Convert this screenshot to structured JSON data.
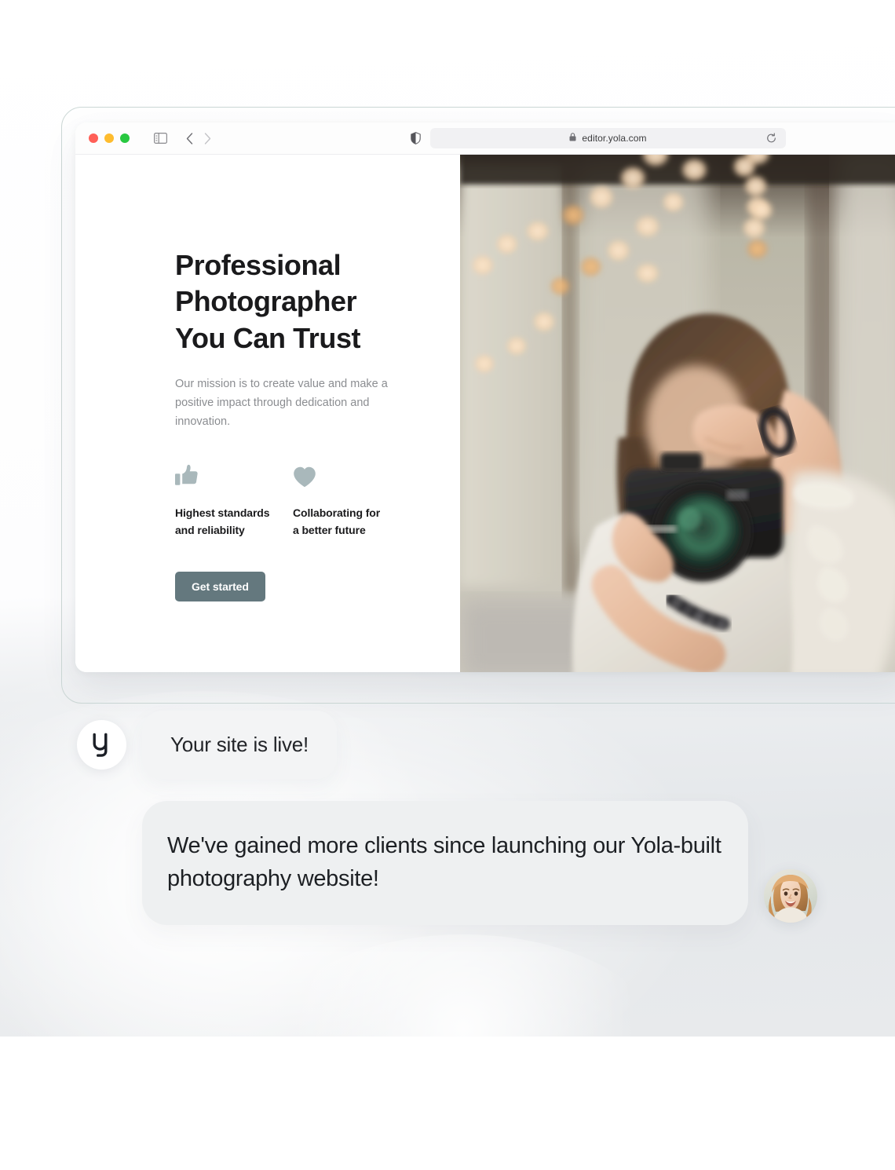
{
  "browser": {
    "traffic_lights": [
      {
        "name": "close",
        "color": "#ff5f57"
      },
      {
        "name": "minimize",
        "color": "#febc2e"
      },
      {
        "name": "maximize",
        "color": "#28c840"
      }
    ],
    "sidebar_toggle_icon": "sidebar-toggle-icon",
    "back_icon": "chevron-left-icon",
    "forward_icon": "chevron-right-icon",
    "shield_icon": "shield-privacy-icon",
    "lock_icon": "lock-icon",
    "url": "editor.yola.com",
    "reload_icon": "reload-icon"
  },
  "hero": {
    "heading": "Professional\nPhotographer\nYou Can Trust",
    "subtext": "Our mission is to create value and make a positive impact through dedication and innovation.",
    "features": [
      {
        "icon": "thumbs-up-icon",
        "label": "Highest standards\nand reliability"
      },
      {
        "icon": "heart-icon",
        "label": "Collaborating for\na better future"
      }
    ],
    "cta_label": "Get started",
    "photo_alt": "photographer-holding-camera-photo"
  },
  "chat": {
    "brand_logo_letter": "y",
    "message_1": "Your site is live!",
    "message_2": "We've gained more clients since launching our Yola-built photography website!",
    "user_avatar_alt": "smiling-woman-avatar"
  },
  "colors": {
    "cta_background": "#64787e",
    "feature_icon": "#a9b8bb",
    "heading_text": "#1a1a1c",
    "body_text": "#8b8d91",
    "bubble_light": "#f3f4f5",
    "bubble_gray": "#eef0f1",
    "frame_border": "#ccd8d6"
  }
}
